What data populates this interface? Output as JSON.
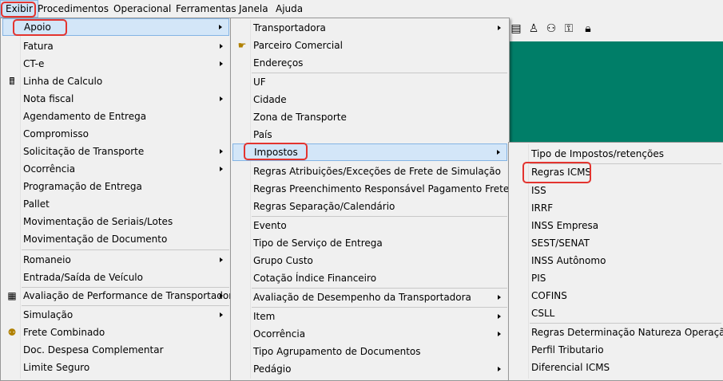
{
  "menubar": {
    "items": [
      {
        "label": "Exibir"
      },
      {
        "label": "Procedimentos"
      },
      {
        "label": "Operacional"
      },
      {
        "label": "Ferramentas"
      },
      {
        "label": "Janela"
      },
      {
        "label": "Ajuda"
      }
    ]
  },
  "exibir_menu": {
    "items": [
      {
        "label": "Apoio"
      },
      {
        "label": "Fatura"
      },
      {
        "label": "CT-e"
      },
      {
        "label": "Linha de Calculo"
      },
      {
        "label": "Nota fiscal"
      },
      {
        "label": "Agendamento de Entrega"
      },
      {
        "label": "Compromisso"
      },
      {
        "label": "Solicitação de Transporte"
      },
      {
        "label": "Ocorrência"
      },
      {
        "label": "Programação de Entrega"
      },
      {
        "label": "Pallet"
      },
      {
        "label": "Movimentação de Seriais/Lotes"
      },
      {
        "label": "Movimentação de Documento"
      },
      {
        "label": "Romaneio"
      },
      {
        "label": "Entrada/Saída de Veículo"
      },
      {
        "label": "Avaliação de Performance de Transportadora"
      },
      {
        "label": "Simulação"
      },
      {
        "label": "Frete Combinado"
      },
      {
        "label": "Doc. Despesa Complementar"
      },
      {
        "label": "Limite Seguro"
      }
    ]
  },
  "apoio_menu": {
    "items": [
      {
        "label": "Transportadora"
      },
      {
        "label": "Parceiro Comercial"
      },
      {
        "label": "Endereços"
      },
      {
        "label": "UF"
      },
      {
        "label": "Cidade"
      },
      {
        "label": "Zona de Transporte"
      },
      {
        "label": "País"
      },
      {
        "label": "Impostos"
      },
      {
        "label": "Regras Atribuições/Exceções de Frete de Simulação"
      },
      {
        "label": "Regras Preenchimento Responsável Pagamento Frete ST"
      },
      {
        "label": "Regras Separação/Calendário"
      },
      {
        "label": "Evento"
      },
      {
        "label": "Tipo de Serviço de Entrega"
      },
      {
        "label": "Grupo Custo"
      },
      {
        "label": "Cotação Índice Financeiro"
      },
      {
        "label": "Avaliação de Desempenho da Transportadora"
      },
      {
        "label": "Item"
      },
      {
        "label": "Ocorrência"
      },
      {
        "label": "Tipo Agrupamento de Documentos"
      },
      {
        "label": "Pedágio"
      }
    ]
  },
  "impostos_menu": {
    "items": [
      {
        "label": "Tipo de Impostos/retenções"
      },
      {
        "label": "Regras ICMS"
      },
      {
        "label": "ISS"
      },
      {
        "label": "IRRF"
      },
      {
        "label": "INSS Empresa"
      },
      {
        "label": "SEST/SENAT"
      },
      {
        "label": "INSS Autônomo"
      },
      {
        "label": "PIS"
      },
      {
        "label": "COFINS"
      },
      {
        "label": "CSLL"
      },
      {
        "label": "Regras Determinação Natureza Operação"
      },
      {
        "label": "Perfil Tributario"
      },
      {
        "label": "Diferencial ICMS"
      }
    ]
  },
  "colors": {
    "workspace": "#007e68",
    "highlight": "#d3e6f8",
    "annotation": "#e3342f"
  }
}
